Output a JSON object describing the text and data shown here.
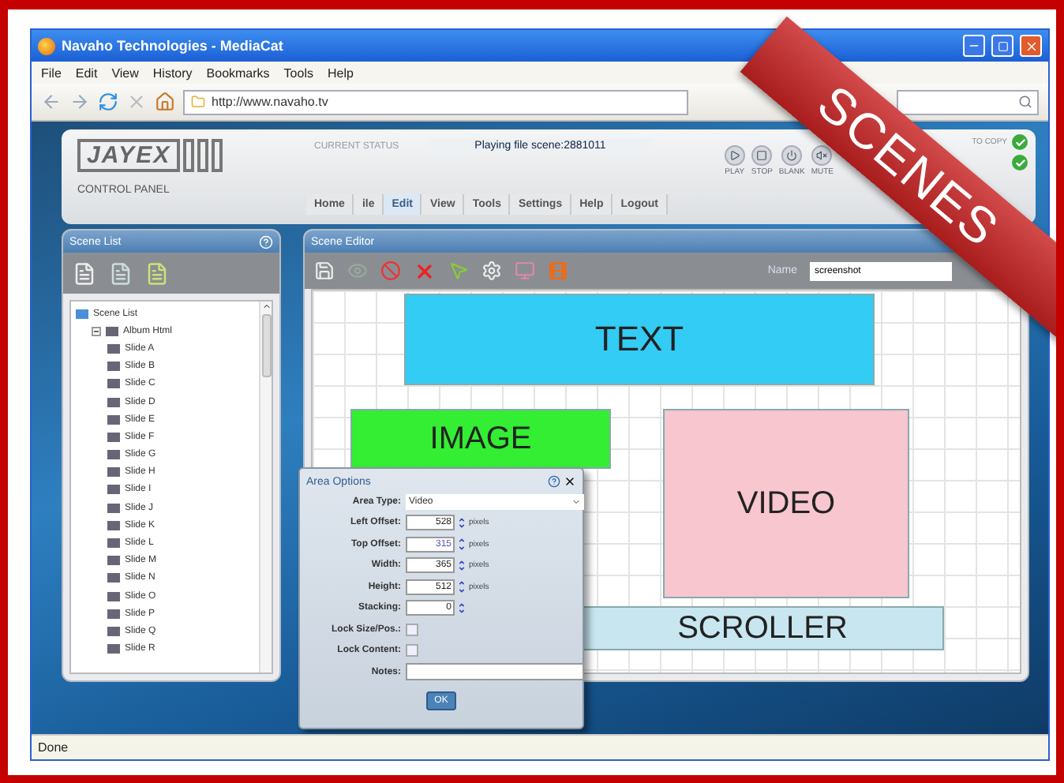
{
  "browser": {
    "title": "Navaho Technologies - MediaCat",
    "menu": [
      "File",
      "Edit",
      "View",
      "History",
      "Bookmarks",
      "Tools",
      "Help"
    ],
    "address": "http://www.navaho.tv",
    "status": "Done"
  },
  "header": {
    "logo": "JAYEX",
    "subtitle": "CONTROL PANEL",
    "status_label": "CURRENT STATUS",
    "status": "Playing file scene:2881011",
    "controls": [
      {
        "label": "PLAY",
        "kind": "play"
      },
      {
        "label": "STOP",
        "kind": "stop"
      },
      {
        "label": "BLANK",
        "kind": "blank"
      },
      {
        "label": "MUTE",
        "kind": "mute"
      }
    ],
    "toggles": [
      {
        "label": "TO COPY",
        "checked": true
      },
      {
        "checked": true
      }
    ]
  },
  "nav_tabs": [
    {
      "label": "Home",
      "selected": false
    },
    {
      "label": "ile",
      "selected": false
    },
    {
      "label": "Edit",
      "selected": true
    },
    {
      "label": "View",
      "selected": false
    },
    {
      "label": "Tools",
      "selected": false
    },
    {
      "label": "Settings",
      "selected": false
    },
    {
      "label": "Help",
      "selected": false
    },
    {
      "label": "Logout",
      "selected": false
    }
  ],
  "scene_list": {
    "title": "Scene List",
    "tree": [
      {
        "label": "Scene List",
        "children": [
          {
            "label": "Album Html",
            "expanded": true,
            "children": [
              {
                "label": "Slide A"
              },
              {
                "label": "Slide B"
              },
              {
                "label": "Slide C"
              },
              {
                "label": "Slide D"
              },
              {
                "label": "Slide E"
              },
              {
                "label": "Slide F"
              },
              {
                "label": "Slide G"
              },
              {
                "label": "Slide H"
              },
              {
                "label": "Slide I"
              },
              {
                "label": "Slide J"
              },
              {
                "label": "Slide K"
              },
              {
                "label": "Slide L"
              },
              {
                "label": "Slide M"
              },
              {
                "label": "Slide N"
              },
              {
                "label": "Slide O"
              },
              {
                "label": "Slide P"
              },
              {
                "label": "Slide Q"
              },
              {
                "label": "Slide R"
              }
            ]
          }
        ]
      }
    ]
  },
  "scene_editor": {
    "title": "Scene Editor",
    "name_label": "Name",
    "name_value": "screenshot",
    "areas": [
      {
        "label": "TEXT",
        "color": "#33ccf5"
      },
      {
        "label": "IMAGE",
        "color": "#33ee33"
      },
      {
        "label": "VIDEO",
        "color": "#f8c6cf"
      },
      {
        "label": "SCROLLER",
        "color": "#c8e6f0"
      }
    ]
  },
  "dialog": {
    "title": "Area Options",
    "fields": [
      {
        "kind": "select",
        "label": "Area Type:",
        "value": "Video"
      },
      {
        "kind": "spinner",
        "label": "Left Offset:",
        "value": "528",
        "unit": "pixels"
      },
      {
        "kind": "spinner",
        "label": "Top Offset:",
        "value": "315",
        "unit": "pixels"
      },
      {
        "kind": "spinner",
        "label": "Width:",
        "value": "365",
        "unit": "pixels"
      },
      {
        "kind": "spinner",
        "label": "Height:",
        "value": "512",
        "unit": "pixels"
      },
      {
        "kind": "spinner",
        "label": "Stacking:",
        "value": "0"
      },
      {
        "kind": "checkbox",
        "label": "Lock Size/Pos.:",
        "checked": false
      },
      {
        "kind": "checkbox",
        "label": "Lock Content:",
        "checked": false
      },
      {
        "kind": "text",
        "label": "Notes:"
      }
    ],
    "button": "OK"
  },
  "ribbon": "SCENES"
}
